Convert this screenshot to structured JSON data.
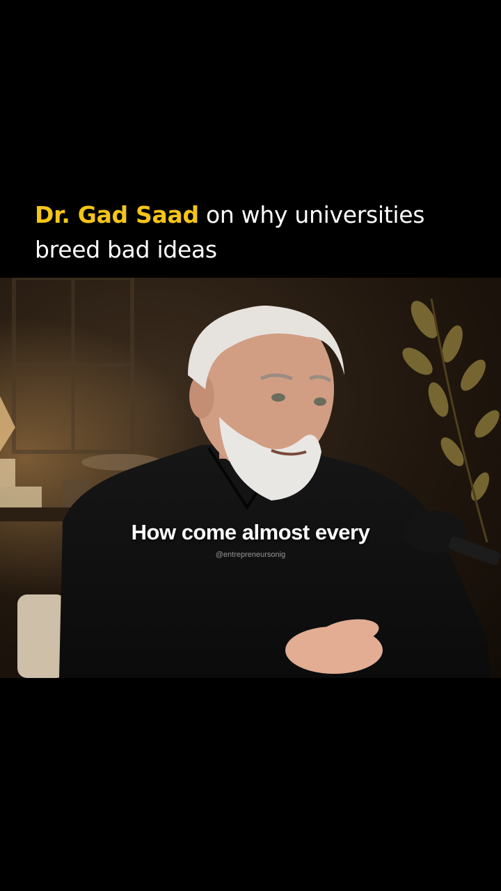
{
  "headline": {
    "highlight": "Dr. Gad Saad",
    "rest": " on why universities breed bad ideas"
  },
  "video": {
    "caption": "How come almost every",
    "watermark": "@entrepreneursonig"
  },
  "colors": {
    "background": "#000000",
    "highlight": "#f5c518",
    "text": "#ffffff"
  }
}
